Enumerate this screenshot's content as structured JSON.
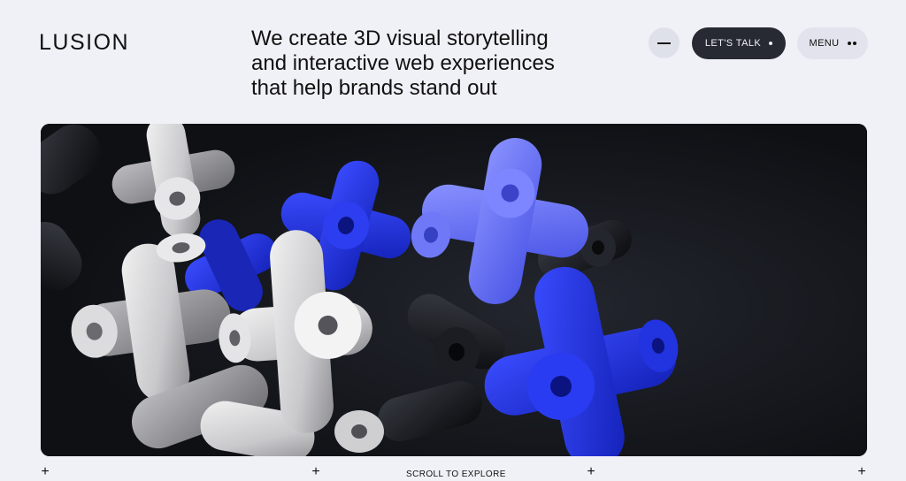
{
  "brand": {
    "logo": "LUSION"
  },
  "hero_text": {
    "line1": "We create 3D visual storytelling",
    "line2": "and interactive web experiences",
    "line3": "that help brands stand out"
  },
  "header": {
    "lets_talk_label": "LET'S TALK",
    "menu_label": "MENU"
  },
  "footer": {
    "scroll_label": "SCROLL TO EXPLORE"
  },
  "colors": {
    "background": "#f0f0f7",
    "accent_blue": "#1f2fe0",
    "dark_button": "#272a33"
  },
  "icons": [
    "minus-icon",
    "dot-icon",
    "two-dots-icon",
    "plus-icon"
  ]
}
